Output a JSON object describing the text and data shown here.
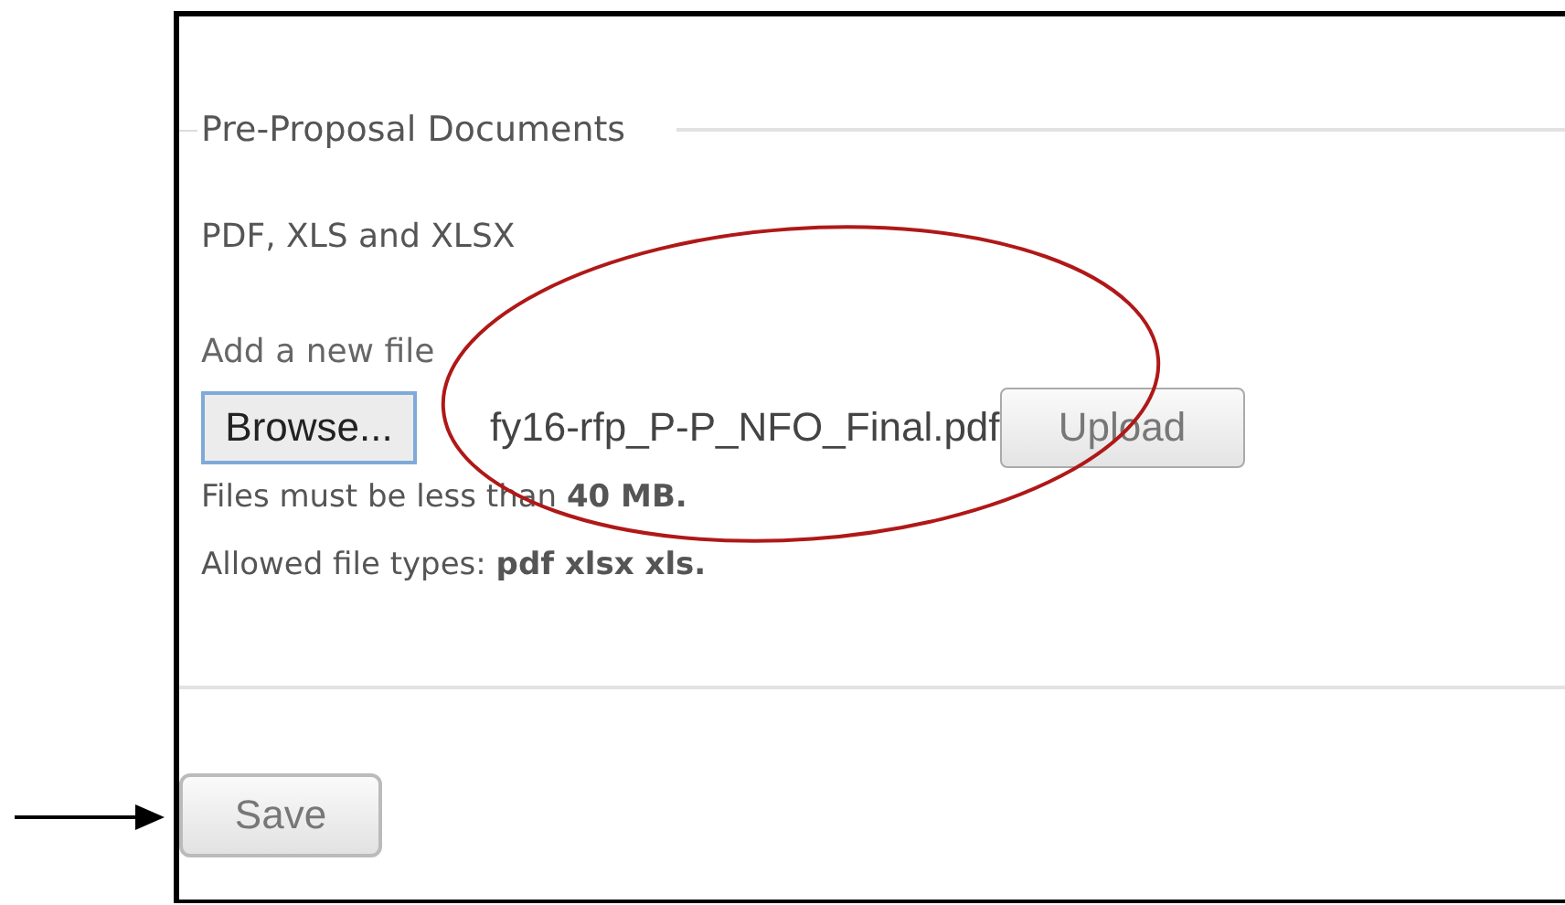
{
  "fieldset": {
    "legend": "Pre-Proposal Documents",
    "formats": "PDF, XLS and XLSX",
    "add_label": "Add a new file",
    "browse_button": "Browse...",
    "file_name": "fy16-rfp_P-P_NFO_Final.pdf",
    "upload_button": "Upload",
    "size_note": "Files must be less than **40 MB.**",
    "types_note": "Allowed file types: **pdf xlsx xls.**"
  },
  "save_button": "Save",
  "annotations": [
    {
      "kind": "ellipse",
      "color": "#b01818"
    },
    {
      "kind": "arrow",
      "color": "#000000"
    }
  ]
}
